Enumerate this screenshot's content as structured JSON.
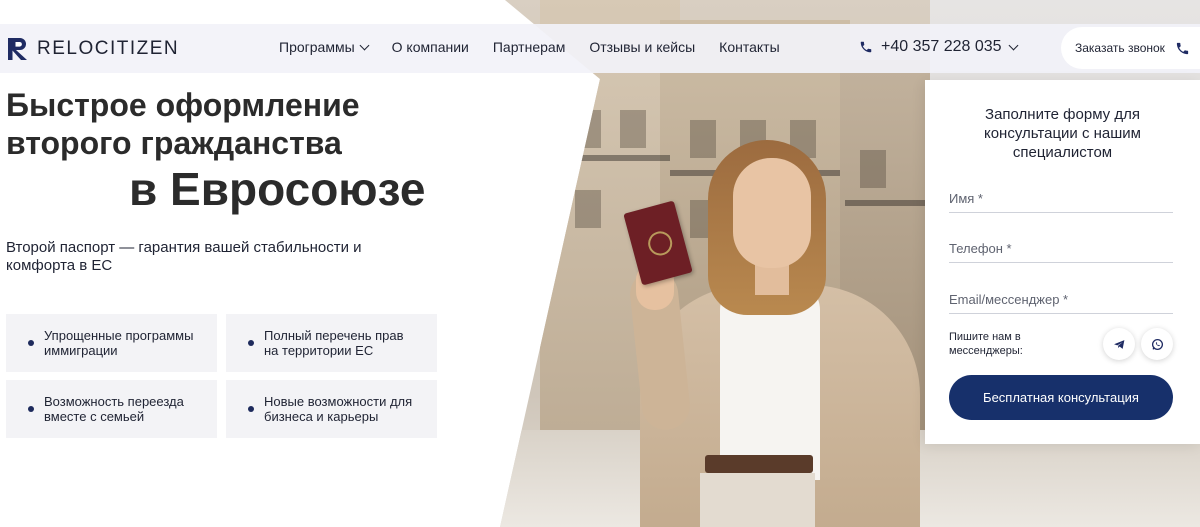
{
  "brand": {
    "name": "RELOCITIZEN",
    "accent_color": "#17306b"
  },
  "header": {
    "menu": [
      {
        "label": "Программы",
        "has_dropdown": true
      },
      {
        "label": "О компании",
        "has_dropdown": false
      },
      {
        "label": "Партнерам",
        "has_dropdown": false
      },
      {
        "label": "Отзывы и кейсы",
        "has_dropdown": false
      },
      {
        "label": "Контакты",
        "has_dropdown": false
      }
    ],
    "phone": "+40 357 228 035",
    "callback_label": "Заказать звонок"
  },
  "hero": {
    "title_line1": "Быстрое оформление",
    "title_line2": "второго гражданства",
    "title_line3": "в Евросоюзе",
    "subtitle": "Второй паспорт — гарантия вашей стабильности и комфорта в ЕС",
    "benefits": [
      "Упрощенные программы иммиграции",
      "Полный перечень прав на территории ЕС",
      "Возможность переезда вместе с семьей",
      "Новые возможности для бизнеса и карьеры"
    ]
  },
  "form": {
    "title": "Заполните форму для консультации с нашим специалистом",
    "fields": [
      {
        "placeholder": "Имя *"
      },
      {
        "placeholder": "Телефон *"
      },
      {
        "placeholder": "Email/мессенджер *"
      }
    ],
    "messenger_label": "Пишите нам в мессенджеры:",
    "messenger_icons": [
      "telegram-icon",
      "whatsapp-icon"
    ],
    "submit_label": "Бесплатная консультация"
  }
}
